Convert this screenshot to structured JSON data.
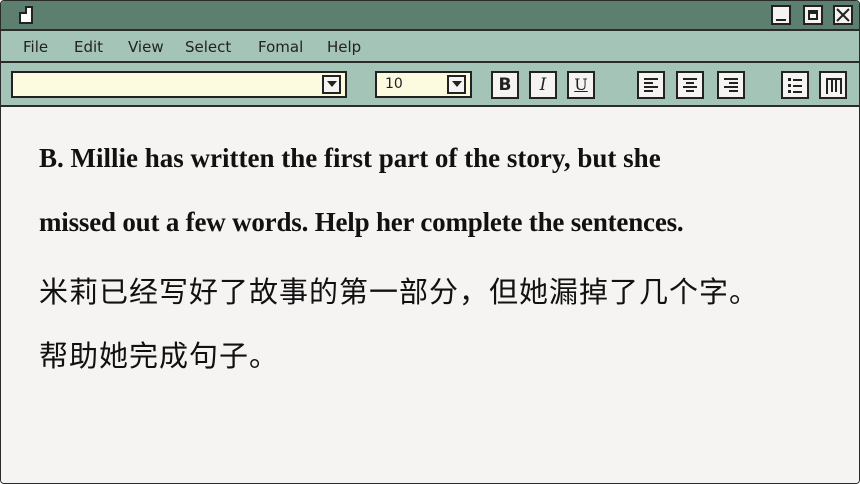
{
  "window": {
    "icons": {
      "document": "document-icon",
      "minimize": "minimize-icon",
      "maximize": "maximize-icon",
      "close": "close-icon"
    }
  },
  "menu": {
    "items": [
      "File",
      "Edit",
      "View",
      "Select",
      "Fomal",
      "Help"
    ]
  },
  "toolbar": {
    "font_value": "",
    "size_value": "10",
    "bold_label": "B",
    "italic_label": "I",
    "underline_label": "U",
    "icons": [
      "dropdown-arrow-icon",
      "align-left-icon",
      "align-center-icon",
      "align-right-icon",
      "bullet-list-icon",
      "columns-icon"
    ]
  },
  "document": {
    "lines": [
      "B. Millie has written the first part of the story, but she",
      "missed out a few words. Help her complete the sentences.",
      "米莉已经写好了故事的第一部分，但她漏掉了几个字。",
      "帮助她完成句子。"
    ]
  },
  "colors": {
    "titlebar": "#5c7f6f",
    "menubar": "#a4c4b7",
    "input_bg": "#fcfbdf",
    "canvas": "#f5f4f2"
  }
}
